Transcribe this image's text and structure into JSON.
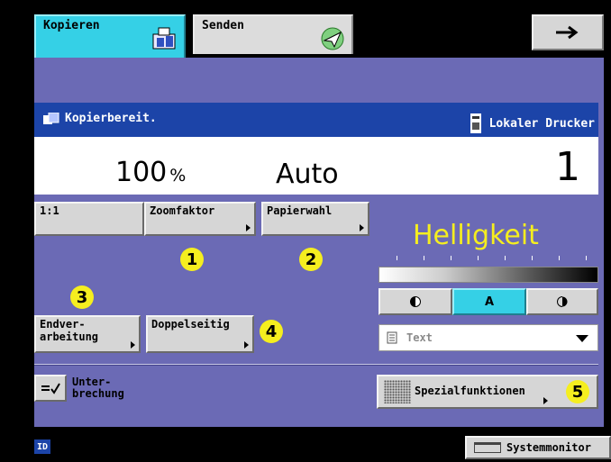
{
  "tabs": {
    "copy_label": "Kopieren",
    "send_label": "Senden"
  },
  "status": {
    "message": "Kopierbereit.",
    "printer": "Lokaler Drucker",
    "zoom_value": "100",
    "zoom_unit": "%",
    "paper_value": "Auto",
    "copies": "1"
  },
  "buttons": {
    "ratio_11": "1:1",
    "zoom": "Zoomfaktor",
    "paper": "Papierwahl",
    "finishing_line1": "Endver-",
    "finishing_line2": "arbeitung",
    "duplex": "Doppelseitig",
    "interrupt_line1": "Unter-",
    "interrupt_line2": "brechung",
    "special": "Spezialfunktionen"
  },
  "density": {
    "title": "Helligkeit",
    "auto_label": "A",
    "mode_selected": "Text",
    "active": "auto"
  },
  "callouts": [
    "1",
    "2",
    "3",
    "4",
    "5"
  ],
  "bottom": {
    "id_label": "ID",
    "system_monitor": "Systemmonitor"
  },
  "colors": {
    "panel": "#6b6ab5",
    "active_tab": "#35d0e6",
    "header": "#1c44a8",
    "callout": "#f5ee1f"
  }
}
